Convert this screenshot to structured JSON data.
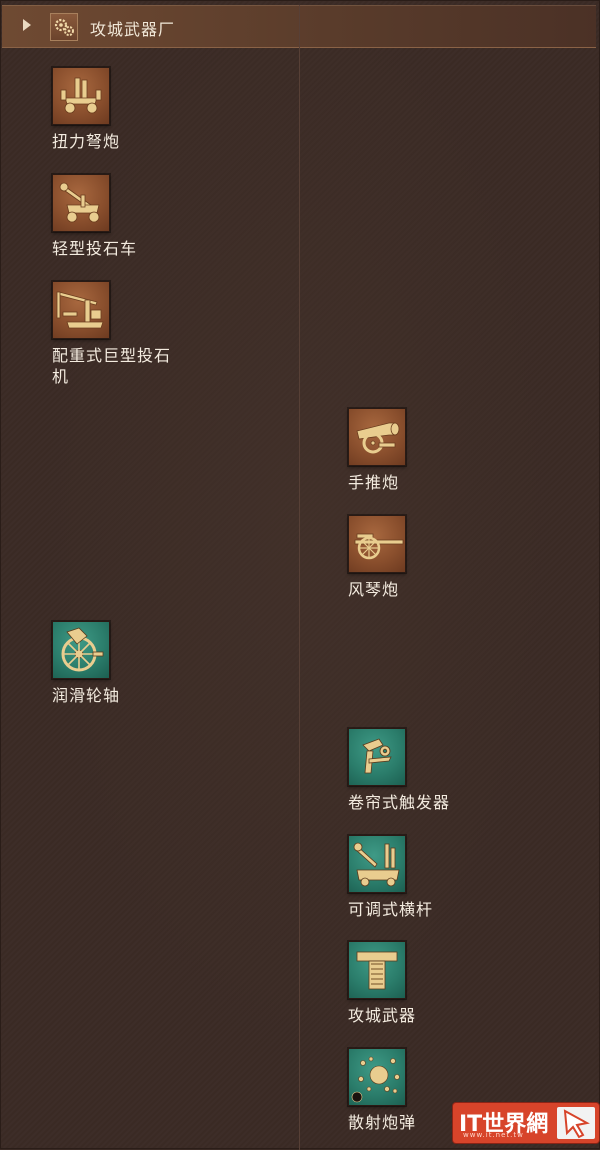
{
  "header": {
    "title": "攻城武器厂",
    "expand_icon": "caret-right-icon",
    "category_icon": "gears-icon"
  },
  "nodes": [
    {
      "id": "torsion-ballista",
      "label": "扭力弩炮",
      "color": "brown",
      "icon": "ballista-icon"
    },
    {
      "id": "light-catapult",
      "label": "轻型投石车",
      "color": "brown",
      "icon": "catapult-icon"
    },
    {
      "id": "trebuchet",
      "label": "配重式巨型投石机",
      "color": "brown",
      "icon": "trebuchet-icon"
    },
    {
      "id": "handcannon",
      "label": "手推炮",
      "color": "brown",
      "icon": "cannon-icon"
    },
    {
      "id": "organ-gun",
      "label": "风琴炮",
      "color": "brown",
      "icon": "organ-gun-icon"
    },
    {
      "id": "lubricated-axle",
      "label": "润滑轮轴",
      "color": "teal",
      "icon": "wheel-axle-icon"
    },
    {
      "id": "roller-trigger",
      "label": "卷帘式触发器",
      "color": "teal",
      "icon": "trigger-icon"
    },
    {
      "id": "adjustable-lever",
      "label": "可调式横杆",
      "color": "teal",
      "icon": "lever-icon"
    },
    {
      "id": "siege-weapons",
      "label": "攻城武器",
      "color": "teal",
      "icon": "siege-tech-icon"
    },
    {
      "id": "canister-shot",
      "label": "散射炮弹",
      "color": "teal",
      "icon": "canister-shot-icon"
    }
  ],
  "watermark": {
    "text": "IT世界網",
    "subtext": "www.it.net.tw",
    "icon": "cursor-arrow-icon"
  },
  "colors": {
    "background": "#3b2b25",
    "header": "#6f4a32",
    "unit_tile": "#8a4f2d",
    "tech_tile": "#2b7d6b",
    "icon_gold": "#e6c98a"
  }
}
